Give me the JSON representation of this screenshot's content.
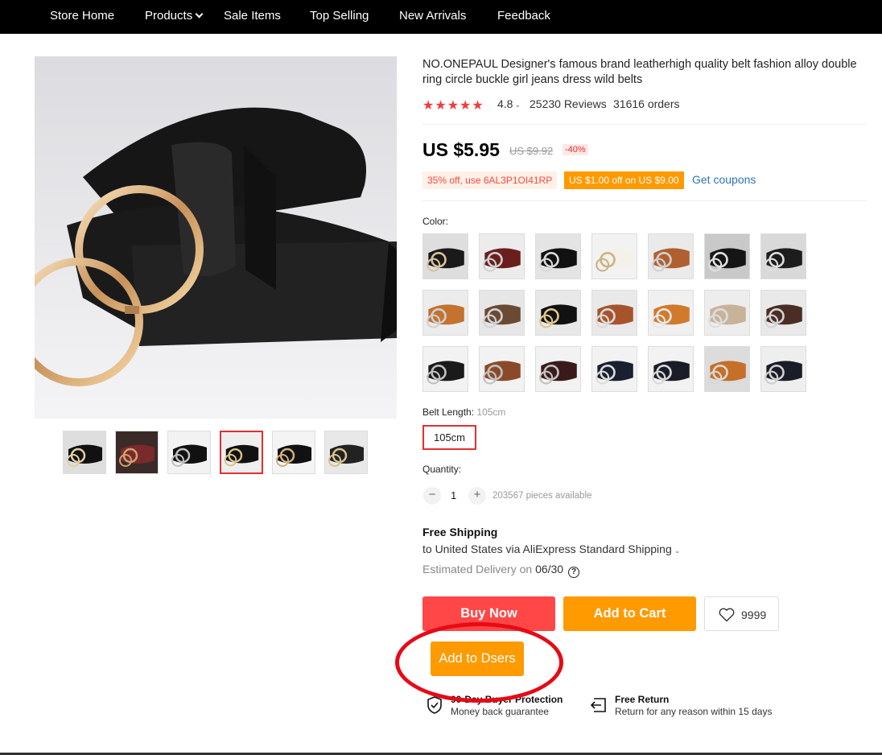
{
  "nav": {
    "items": [
      "Store Home",
      "Products",
      "Sale Items",
      "Top Selling",
      "New Arrivals",
      "Feedback"
    ]
  },
  "product": {
    "title": "NO.ONEPAUL Designer's famous brand leatherhigh quality belt fashion alloy double ring circle buckle girl jeans dress wild belts",
    "stars": "★★★★★",
    "rating": "4.8",
    "reviews": "25230 Reviews",
    "orders": "31616 orders",
    "price": "US $5.95",
    "old_price": "US $9.92",
    "discount": "-40%",
    "promo_code": "35% off, use 6AL3P1OI41RP",
    "promo_coupon": "US $1.00 off on US $9.00",
    "get_coupons": "Get coupons"
  },
  "options": {
    "color_label": "Color:",
    "belt_length_label": "Belt Length:",
    "belt_length_value": "105cm",
    "belt_length_option": "105cm",
    "quantity_label": "Quantity:",
    "quantity_value": "1",
    "quantity_minus": "−",
    "quantity_plus": "+",
    "available": "203567 pieces available"
  },
  "shipping": {
    "title": "Free Shipping",
    "line": "to United States via AliExpress Standard Shipping",
    "delivery_label": "Estimated Delivery on",
    "delivery_date": "06/30",
    "help": "?"
  },
  "actions": {
    "buy_now": "Buy Now",
    "add_to_cart": "Add to Cart",
    "wishlist_count": "9999",
    "add_to_dsers": "Add to Dsers"
  },
  "guarantees": {
    "buyer_title": "90-Day Buyer Protection",
    "buyer_sub": "Money back guarantee",
    "return_title": "Free Return",
    "return_sub": "Return for any reason within 15 days"
  },
  "colors": {
    "accent_red": "#ff4747",
    "accent_orange": "#ff9a00",
    "annotation": "#e60a17"
  },
  "swatches": [
    {
      "bg": "#dedede",
      "belt": "#1a1a1a",
      "ring": "#d9c29a"
    },
    {
      "bg": "#ececec",
      "belt": "#6b1e1e",
      "ring": "#cfcfcf"
    },
    {
      "bg": "#e4e4e4",
      "belt": "#111111",
      "ring": "#d8d8d8"
    },
    {
      "bg": "#f2f2f2",
      "belt": "#f4f1ea",
      "ring": "#c9b38a"
    },
    {
      "bg": "#eaeaea",
      "belt": "#b06030",
      "ring": "#d0d0d0"
    },
    {
      "bg": "#c9c9c9",
      "belt": "#151515",
      "ring": "#e0e0e0"
    },
    {
      "bg": "#d9d9d9",
      "belt": "#1d1d1d",
      "ring": "#dddddd"
    },
    {
      "bg": "#ececec",
      "belt": "#c4722f",
      "ring": "#cfcfcf"
    },
    {
      "bg": "#e6e6e6",
      "belt": "#6a4a32",
      "ring": "#d2d2d2"
    },
    {
      "bg": "#e8e8e8",
      "belt": "#111111",
      "ring": "#e0c48a"
    },
    {
      "bg": "#e9e9e9",
      "belt": "#a8542a",
      "ring": "#dadada"
    },
    {
      "bg": "#f0f0f0",
      "belt": "#d27a2c",
      "ring": "#e6e6e6"
    },
    {
      "bg": "#ededed",
      "belt": "#c7b399",
      "ring": "#dddddd"
    },
    {
      "bg": "#e9e9e9",
      "belt": "#4a2d25",
      "ring": "#d4d4d4"
    },
    {
      "bg": "#f2f2f2",
      "belt": "#1a1a1a",
      "ring": "#bfbfbf"
    },
    {
      "bg": "#f2f2f2",
      "belt": "#8a4a2a",
      "ring": "#c0c0c0"
    },
    {
      "bg": "#f2f2f2",
      "belt": "#3a1a1a",
      "ring": "#c0c0c0"
    },
    {
      "bg": "#f2f2f2",
      "belt": "#1b2030",
      "ring": "#dcdcdc"
    },
    {
      "bg": "#f2f2f2",
      "belt": "#1a1d28",
      "ring": "#d8d8d8"
    },
    {
      "bg": "#dcdcdc",
      "belt": "#c66f28",
      "ring": "#d8d8d8"
    },
    {
      "bg": "#eeeeee",
      "belt": "#1a1d28",
      "ring": "#cfcfcf"
    }
  ],
  "thumbs": [
    {
      "bg": "#dedede",
      "belt": "#111111",
      "ring": "#e0d0a0"
    },
    {
      "bg": "#3a2a28",
      "belt": "#7a2a2a",
      "ring": "#cfa070"
    },
    {
      "bg": "#f2f2f2",
      "belt": "#111111",
      "ring": "#c0c0c0"
    },
    {
      "bg": "#eeeeee",
      "belt": "#111111",
      "ring": "#d8c08a"
    },
    {
      "bg": "#f4f4f4",
      "belt": "#111111",
      "ring": "#d0b080"
    },
    {
      "bg": "#e8e8e8",
      "belt": "#222222",
      "ring": "#d8c090"
    }
  ]
}
